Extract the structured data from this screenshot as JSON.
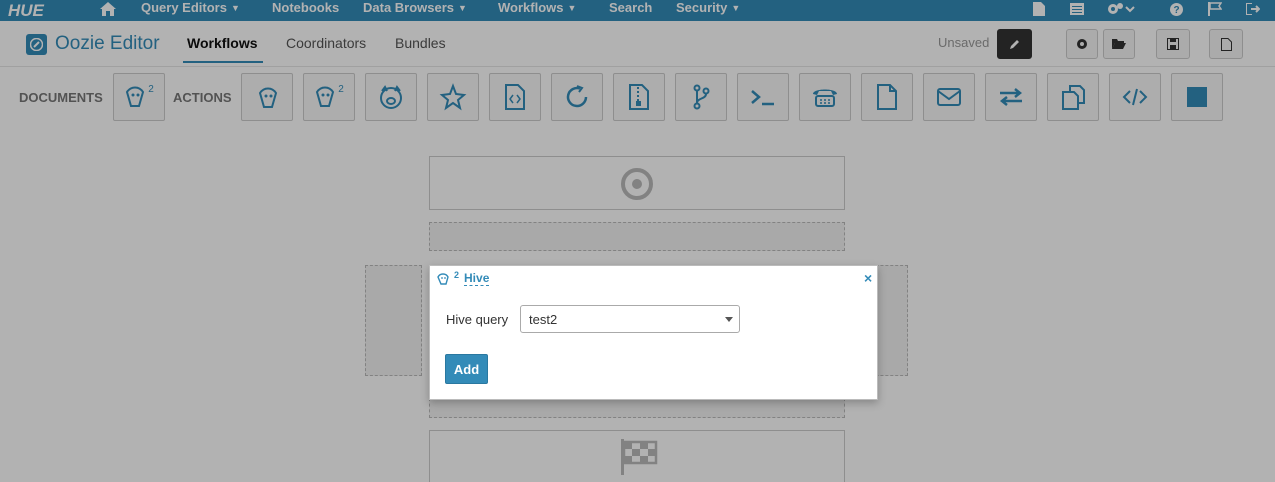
{
  "nav": {
    "logo": "HUE",
    "items": [
      "Query Editors",
      "Notebooks",
      "Data Browsers",
      "Workflows",
      "Search",
      "Security"
    ],
    "icons": [
      "home-icon",
      "document-icon",
      "list-icon",
      "cogs-icon",
      "help-icon",
      "flag-icon",
      "logout-icon"
    ]
  },
  "header": {
    "title": "Oozie Editor",
    "tabs": [
      "Workflows",
      "Coordinators",
      "Bundles"
    ],
    "active_tab": "Workflows",
    "status": "Unsaved"
  },
  "palette": {
    "documents_label": "DOCUMENTS",
    "actions_label": "ACTIONS",
    "document_superscript": "2",
    "hive2_superscript": "2",
    "actions": [
      "hive-icon",
      "hive2-icon",
      "pig-icon",
      "spark-icon",
      "java-icon",
      "subworkflow-icon",
      "fs-icon",
      "fork-icon",
      "shell-icon",
      "ssh-icon",
      "file-icon",
      "email-icon",
      "streaming-icon",
      "distcp-icon",
      "generic-icon",
      "stop-icon"
    ]
  },
  "popover": {
    "title": "Hive",
    "superscript": "2",
    "close": "×",
    "field_label": "Hive query",
    "field_value": "test2",
    "add_label": "Add"
  },
  "colors": {
    "brand": "#338bb8",
    "overlay": "rgba(0,0,0,0.30)"
  }
}
